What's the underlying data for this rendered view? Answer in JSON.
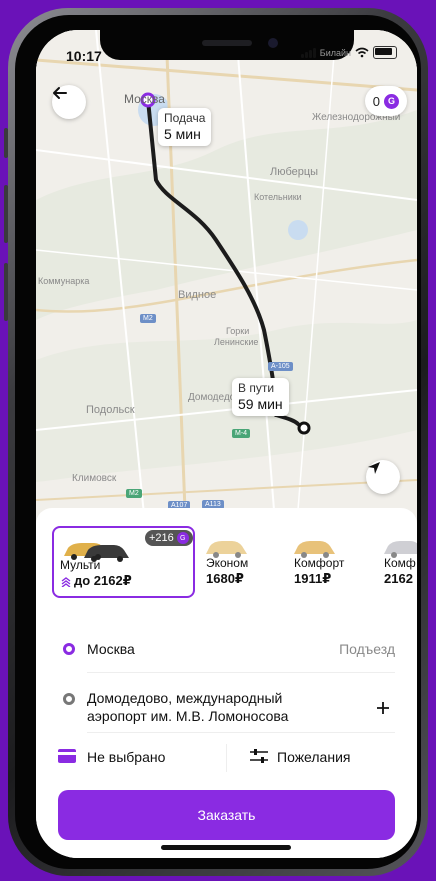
{
  "status": {
    "time": "10:17",
    "carrier": "Билайн"
  },
  "map": {
    "labels": {
      "moscow": "Москва",
      "zheleznodorozhny": "Железнодорожный",
      "lyubertsy": "Люберцы",
      "kotelniki": "Котельники",
      "kommunarka": "Коммунарка",
      "vidnoe": "Видное",
      "gorki": "Горки",
      "leninskie": "Ленинские",
      "podolsk": "Подольск",
      "domodedovo_city": "Домодедово",
      "klimovsk": "Климовск"
    },
    "shields": {
      "m2a": "M2",
      "a105": "A-105",
      "m4": "M-4",
      "m2b": "M2",
      "a107": "A107",
      "a113": "A113"
    }
  },
  "coins": {
    "count": "0",
    "symbol": "G"
  },
  "pickup_bubble": {
    "label": "Подача",
    "time": "5 мин"
  },
  "trip_bubble": {
    "label": "В пути",
    "time": "59 мин"
  },
  "tariffs": [
    {
      "name": "Мульти",
      "price": "до 2162₽",
      "bonus": "+216",
      "selected": true
    },
    {
      "name": "Эконом",
      "price": "1680₽"
    },
    {
      "name": "Комфорт",
      "price": "1911₽"
    },
    {
      "name": "Комф",
      "price": "2162"
    }
  ],
  "route": {
    "from": "Москва",
    "entrance_label": "Подъезд",
    "to_line1": "Домодедово, международный",
    "to_line2": "аэропорт им. М.В. Ломоносова"
  },
  "payment": {
    "label": "Не выбрано"
  },
  "wishes": {
    "label": "Пожелания"
  },
  "order_button": "Заказать",
  "colors": {
    "accent": "#8a2be2",
    "background": "#6a12b8"
  }
}
